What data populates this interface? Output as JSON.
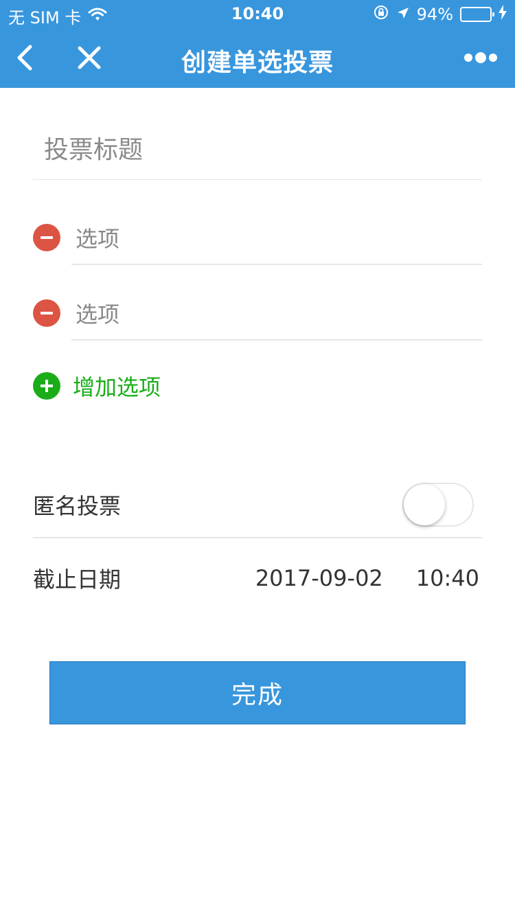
{
  "status_bar": {
    "carrier": "无 SIM 卡",
    "time": "10:40",
    "battery_percent": "94%",
    "battery_level": 0.94,
    "icons": [
      "wifi-icon",
      "orientation-lock-icon",
      "location-icon",
      "battery-icon",
      "charging-icon"
    ]
  },
  "nav": {
    "title": "创建单选投票",
    "icons": [
      "back-arrow-icon",
      "close-icon",
      "more-dots-icon"
    ]
  },
  "form": {
    "title_placeholder": "投票标题",
    "options": [
      {
        "placeholder": "选项"
      },
      {
        "placeholder": "选项"
      }
    ],
    "add_option_label": "增加选项",
    "anonymous_label": "匿名投票",
    "anonymous_enabled": false,
    "deadline_label": "截止日期",
    "deadline_date": "2017-09-02",
    "deadline_time": "10:40",
    "submit_label": "完成"
  },
  "colors": {
    "primary": "#3896dd",
    "remove": "#dc5443",
    "add": "#1aad19",
    "battery": "#4cd964"
  }
}
